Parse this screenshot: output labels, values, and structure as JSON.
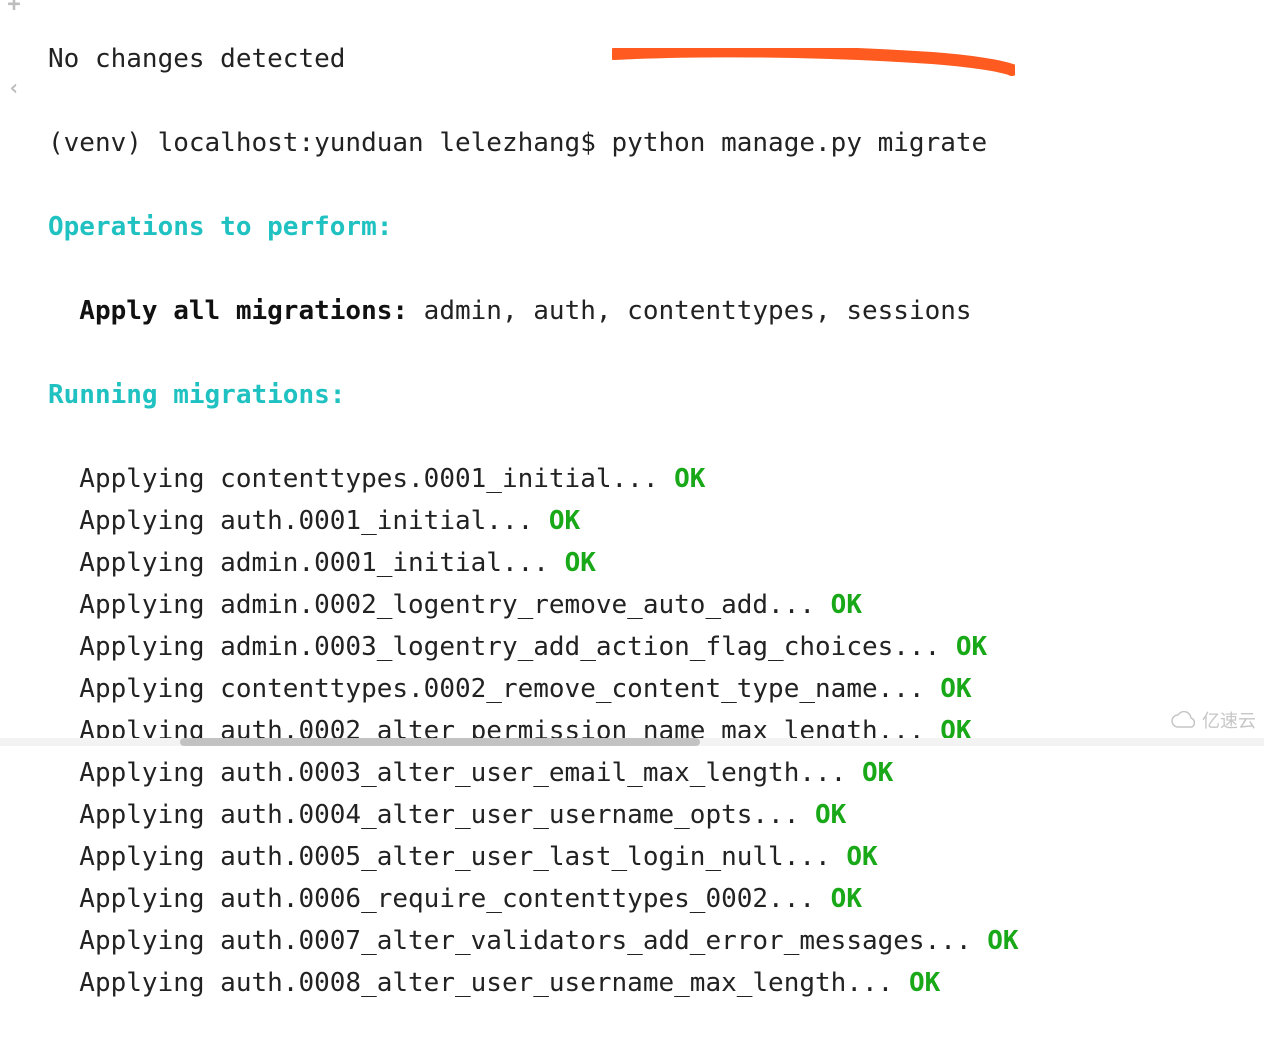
{
  "terminal": {
    "no_changes": "No changes detected",
    "prompt": "(venv) localhost:yunduan lelezhang$ python manage.py migrate",
    "ops_header": "Operations to perform:",
    "apply_all_label": "  Apply all migrations:",
    "apply_all_targets": " admin, auth, contenttypes, sessions",
    "running_header": "Running migrations:",
    "applying_word": "  Applying ",
    "ok": "OK",
    "migrations": [
      "contenttypes.0001_initial",
      "auth.0001_initial",
      "admin.0001_initial",
      "admin.0002_logentry_remove_auto_add",
      "admin.0003_logentry_add_action_flag_choices",
      "contenttypes.0002_remove_content_type_name",
      "auth.0002_alter_permission_name_max_length",
      "auth.0003_alter_user_email_max_length",
      "auth.0004_alter_user_username_opts",
      "auth.0005_alter_user_last_login_null",
      "auth.0006_require_contenttypes_0002",
      "auth.0007_alter_validators_add_error_messages",
      "auth.0008_alter_user_username_max_length"
    ]
  },
  "gutter": {
    "plus": "+",
    "prev": "‹"
  },
  "watermark": {
    "text": "亿速云"
  }
}
